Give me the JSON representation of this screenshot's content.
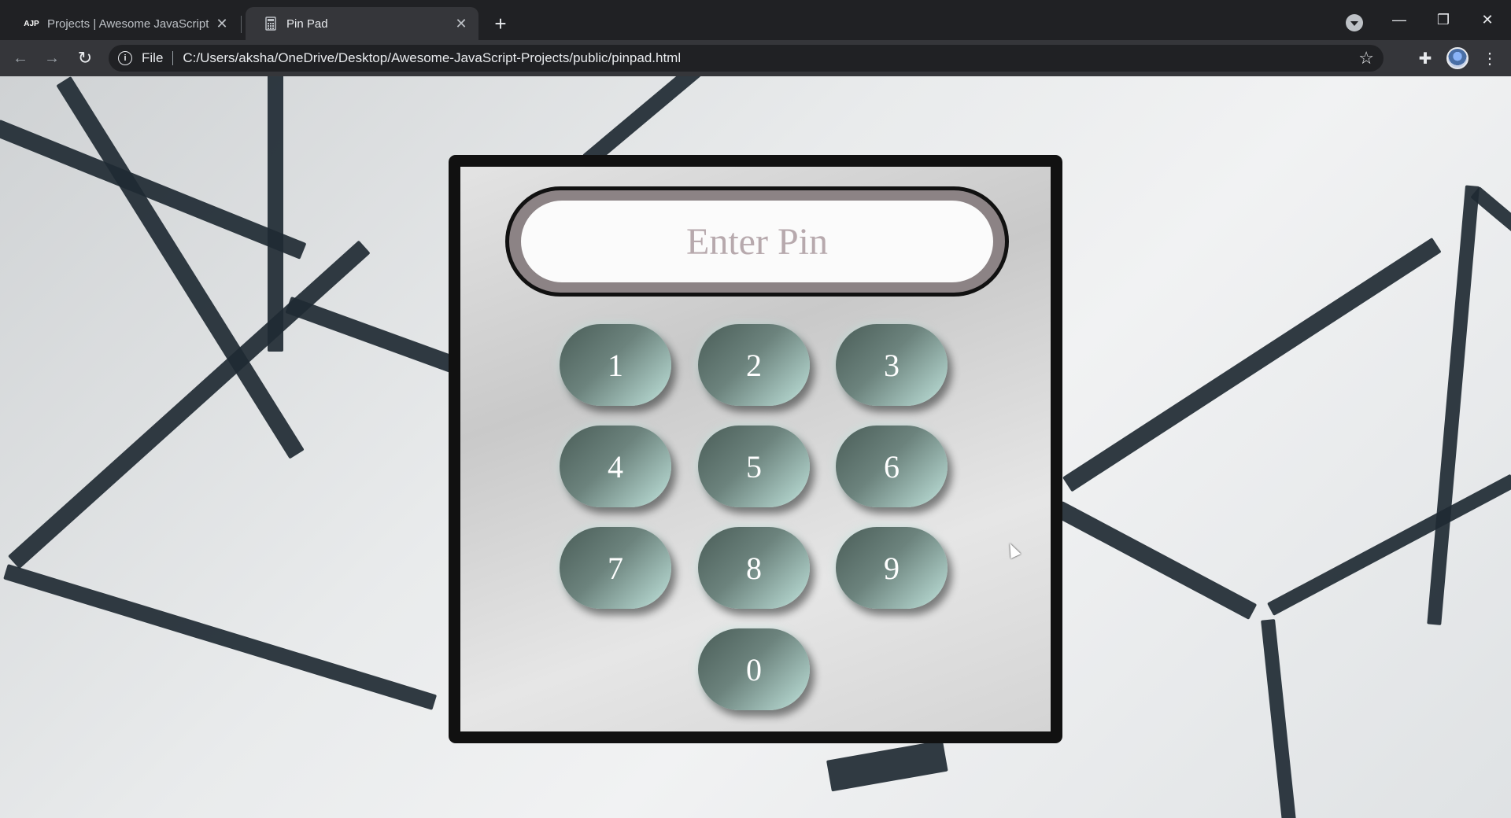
{
  "browser": {
    "tabs": [
      {
        "label": "Projects | Awesome JavaScript",
        "favicon": "AJP"
      },
      {
        "label": "Pin Pad",
        "favicon": "calculator-icon"
      }
    ],
    "omnibox": {
      "scheme": "File",
      "url": "C:/Users/aksha/OneDrive/Desktop/Awesome-JavaScript-Projects/public/pinpad.html"
    }
  },
  "pinpad": {
    "placeholder": "Enter Pin",
    "keys": [
      "1",
      "2",
      "3",
      "4",
      "5",
      "6",
      "7",
      "8",
      "9",
      "0"
    ]
  },
  "colors": {
    "frame": "#111111",
    "display_ring": "#8c8385",
    "key_dark": "#4a5d58",
    "key_light": "#cfe8e2",
    "placeholder_text": "#b7a9ad"
  }
}
